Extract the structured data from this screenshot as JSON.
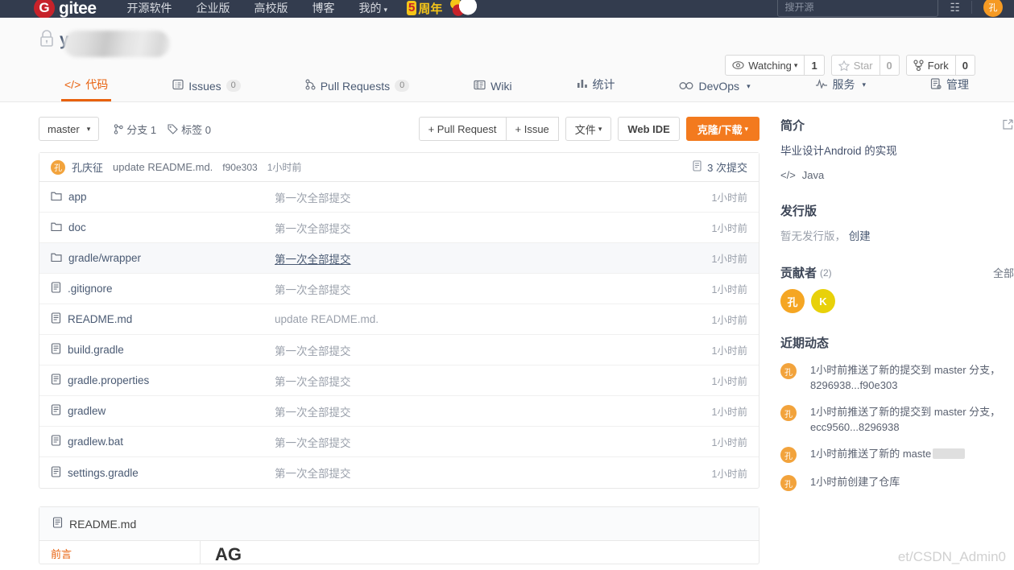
{
  "topnav": {
    "brand_mark": "G",
    "brand_text": "gitee",
    "links": [
      {
        "label": "开源软件",
        "caret": false
      },
      {
        "label": "企业版",
        "caret": false
      },
      {
        "label": "高校版",
        "caret": false
      },
      {
        "label": "博客",
        "caret": false
      },
      {
        "label": "我的",
        "caret": true
      }
    ],
    "anniversary_badge": "5",
    "anniversary_text": "周年",
    "search_placeholder": "搜开源",
    "bell_icon": "notification-icon",
    "avatar_initial": "孔"
  },
  "repo": {
    "visibility_icon": "lock-icon",
    "name_visible_suffix": "yapp",
    "watch": {
      "label": "Watching",
      "count": "1",
      "icon": "eye-icon"
    },
    "star": {
      "label": "Star",
      "count": "0",
      "icon": "star-icon"
    },
    "fork": {
      "label": "Fork",
      "count": "0",
      "icon": "fork-icon"
    }
  },
  "tabs": [
    {
      "label": "代码",
      "icon": "code-icon",
      "badge": null,
      "active": true,
      "caret": false
    },
    {
      "label": "Issues",
      "icon": "issue-icon",
      "badge": "0",
      "active": false,
      "caret": false
    },
    {
      "label": "Pull Requests",
      "icon": "pull-request-icon",
      "badge": "0",
      "active": false,
      "caret": false
    },
    {
      "label": "Wiki",
      "icon": "wiki-icon",
      "badge": null,
      "active": false,
      "caret": false
    },
    {
      "label": "统计",
      "icon": "chart-icon",
      "badge": null,
      "active": false,
      "caret": false
    },
    {
      "label": "DevOps",
      "icon": "infinity-icon",
      "badge": null,
      "active": false,
      "caret": true
    },
    {
      "label": "服务",
      "icon": "pulse-icon",
      "badge": null,
      "active": false,
      "caret": true
    },
    {
      "label": "管理",
      "icon": "settings-icon",
      "badge": null,
      "active": false,
      "caret": false
    }
  ],
  "toolbar": {
    "branch": "master",
    "branches_label": "分支 1",
    "tags_label": "标签 0",
    "pull_request_label": "+ Pull Request",
    "issue_label": "+ Issue",
    "files_label": "文件",
    "web_ide_label": "Web IDE",
    "clone_label": "克隆/下载",
    "clone_color": "#f37a1e"
  },
  "commit_bar": {
    "avatar_initial": "孔",
    "author": "孔庆征",
    "message": "update README.md.",
    "sha": "f90e303",
    "time": "1小时前",
    "commits_label": "3 次提交",
    "commits_icon": "commit-icon"
  },
  "files": [
    {
      "name": "app",
      "type": "folder",
      "message": "第一次全部提交",
      "time": "1小时前",
      "highlight": false,
      "link": false
    },
    {
      "name": "doc",
      "type": "folder",
      "message": "第一次全部提交",
      "time": "1小时前",
      "highlight": false,
      "link": false
    },
    {
      "name": "gradle/wrapper",
      "type": "folder",
      "message": "第一次全部提交",
      "time": "1小时前",
      "highlight": true,
      "link": true
    },
    {
      "name": ".gitignore",
      "type": "file",
      "message": "第一次全部提交",
      "time": "1小时前",
      "highlight": false,
      "link": false
    },
    {
      "name": "README.md",
      "type": "file",
      "message": "update README.md.",
      "time": "1小时前",
      "highlight": false,
      "link": false
    },
    {
      "name": "build.gradle",
      "type": "file",
      "message": "第一次全部提交",
      "time": "1小时前",
      "highlight": false,
      "link": false
    },
    {
      "name": "gradle.properties",
      "type": "file",
      "message": "第一次全部提交",
      "time": "1小时前",
      "highlight": false,
      "link": false
    },
    {
      "name": "gradlew",
      "type": "file",
      "message": "第一次全部提交",
      "time": "1小时前",
      "highlight": false,
      "link": false
    },
    {
      "name": "gradlew.bat",
      "type": "file",
      "message": "第一次全部提交",
      "time": "1小时前",
      "highlight": false,
      "link": false
    },
    {
      "name": "settings.gradle",
      "type": "file",
      "message": "第一次全部提交",
      "time": "1小时前",
      "highlight": false,
      "link": false
    }
  ],
  "readme": {
    "title": "README.md",
    "icon": "file-icon",
    "toc_item": "前言",
    "heading": "AG"
  },
  "sidebar": {
    "about": {
      "heading": "简介",
      "edit_icon": "edit-icon",
      "description": "毕业设计Android 的实现",
      "language": "Java",
      "language_icon": "code-icon"
    },
    "releases": {
      "heading": "发行版",
      "empty_text": "暂无发行版，",
      "create_label": "创建"
    },
    "contributors": {
      "heading": "贡献者",
      "count": "(2)",
      "all_label": "全部",
      "avatars": [
        {
          "initial": "孔",
          "color": "#f5a623"
        },
        {
          "initial": "K",
          "color": "#e8d10a"
        }
      ]
    },
    "activity": {
      "heading": "近期动态",
      "items": [
        {
          "avatar": "孔",
          "text": "1小时前推送了新的提交到 master 分支，8296938...f90e303",
          "redacted": false
        },
        {
          "avatar": "孔",
          "text": "1小时前推送了新的提交到 master 分支，ecc9560...8296938",
          "redacted": false
        },
        {
          "avatar": "孔",
          "text": "1小时前推送了新的 maste",
          "redacted": true
        },
        {
          "avatar": "孔",
          "text": "1小时前创建了仓库",
          "redacted": false
        }
      ]
    }
  },
  "watermark": "et/CSDN_Admin0"
}
